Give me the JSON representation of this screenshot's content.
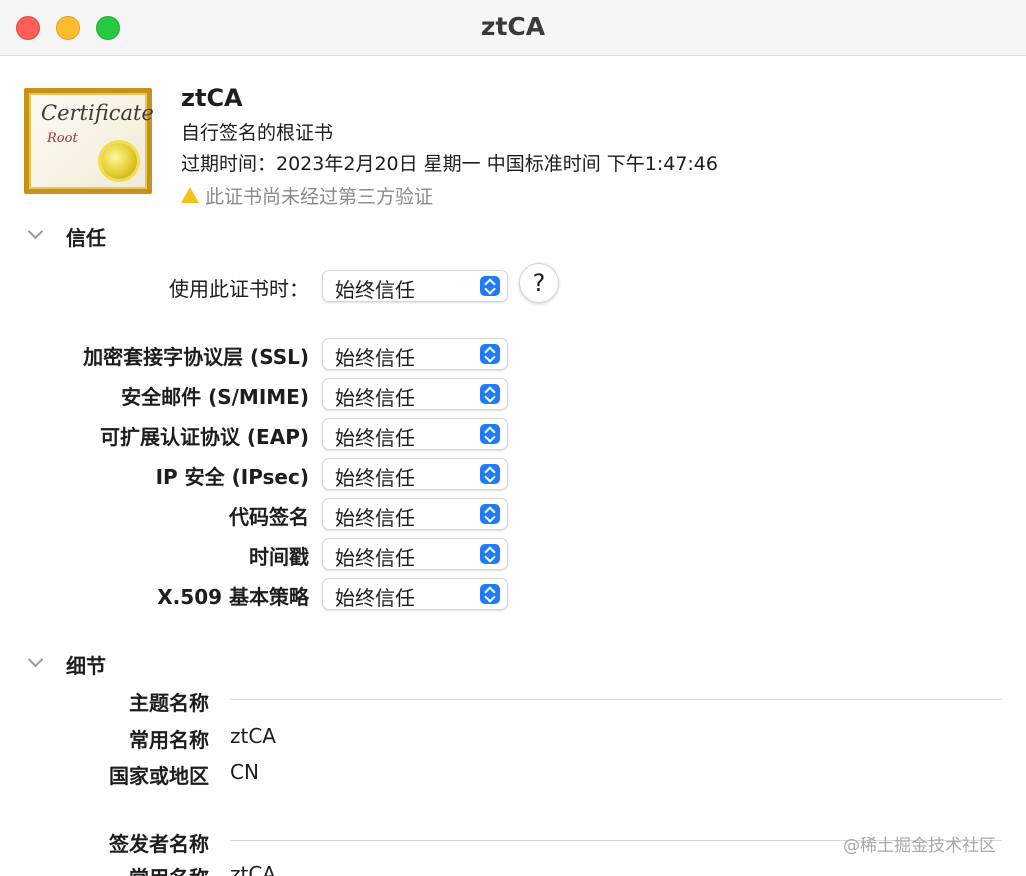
{
  "window": {
    "title": "ztCA"
  },
  "certificate": {
    "icon_text": "Certificate",
    "icon_subtext": "Root",
    "name": "ztCA",
    "type": "自行签名的根证书",
    "expiry": "过期时间：2023年2月20日 星期一 中国标准时间 下午1:47:46",
    "warning": "此证书尚未经过第三方验证"
  },
  "trust": {
    "section_title": "信任",
    "when_using_label": "使用此证书时：",
    "when_using_value": "始终信任",
    "help_label": "?",
    "rows": [
      {
        "label": "加密套接字协议层 (SSL)",
        "value": "始终信任"
      },
      {
        "label": "安全邮件 (S/MIME)",
        "value": "始终信任"
      },
      {
        "label": "可扩展认证协议 (EAP)",
        "value": "始终信任"
      },
      {
        "label": "IP 安全 (IPsec)",
        "value": "始终信任"
      },
      {
        "label": "代码签名",
        "value": "始终信任"
      },
      {
        "label": "时间戳",
        "value": "始终信任"
      },
      {
        "label": "X.509 基本策略",
        "value": "始终信任"
      }
    ]
  },
  "details": {
    "section_title": "细节",
    "subject_heading": "主题名称",
    "subject_common_name_label": "常用名称",
    "subject_common_name_value": "ztCA",
    "subject_country_label": "国家或地区",
    "subject_country_value": "CN",
    "issuer_heading": "签发者名称",
    "issuer_common_name_label": "常用名称",
    "issuer_common_name_value": "ztCA"
  },
  "watermark": "@稀土掘金技术社区",
  "colors": {
    "accent": "#1f7cf7",
    "close": "#fe5f57",
    "minimize": "#febc2e",
    "maximize": "#28c840",
    "warning": "#f5c21b"
  }
}
